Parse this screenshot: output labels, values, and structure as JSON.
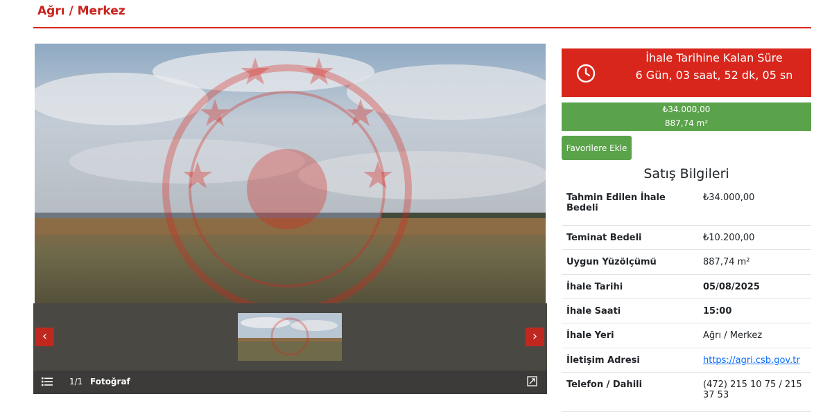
{
  "header": {
    "title": "Ağrı / Merkez"
  },
  "gallery": {
    "counter": "1/1",
    "label": "Fotoğraf",
    "prev_icon": "chevron-left-icon",
    "next_icon": "chevron-right-icon",
    "prev_glyph": "‹",
    "next_glyph": "›"
  },
  "countdown": {
    "title": "İhale Tarihine Kalan Süre",
    "value": "6 Gün, 03 saat, 52 dk, 05 sn",
    "icon": "clock-icon"
  },
  "price": {
    "amount": "₺34.000,00",
    "area": "887,74 m²"
  },
  "favorite_button": "Favorilere Ekle",
  "sale_info": {
    "title": "Satış Bilgileri",
    "rows": [
      {
        "label": "Tahmin Edilen İhale Bedeli",
        "value": "₺34.000,00"
      },
      {
        "label": "Teminat Bedeli",
        "value": "₺10.200,00"
      },
      {
        "label": "Uygun Yüzölçümü",
        "value": "887,74 m²"
      },
      {
        "label": "İhale Tarihi",
        "value": "05/08/2025"
      },
      {
        "label": "İhale Saati",
        "value": "15:00"
      },
      {
        "label": "İhale Yeri",
        "value": "Ağrı / Merkez"
      },
      {
        "label": "İletişim Adresi",
        "value": "https://agri.csb.gov.tr"
      },
      {
        "label": "Telefon / Dahili",
        "value": "(472) 215 10 75 / 215 37 53"
      }
    ]
  },
  "colors": {
    "accent_red": "#d9261c",
    "accent_green": "#5aa34a",
    "link_blue": "#0d6efd"
  }
}
